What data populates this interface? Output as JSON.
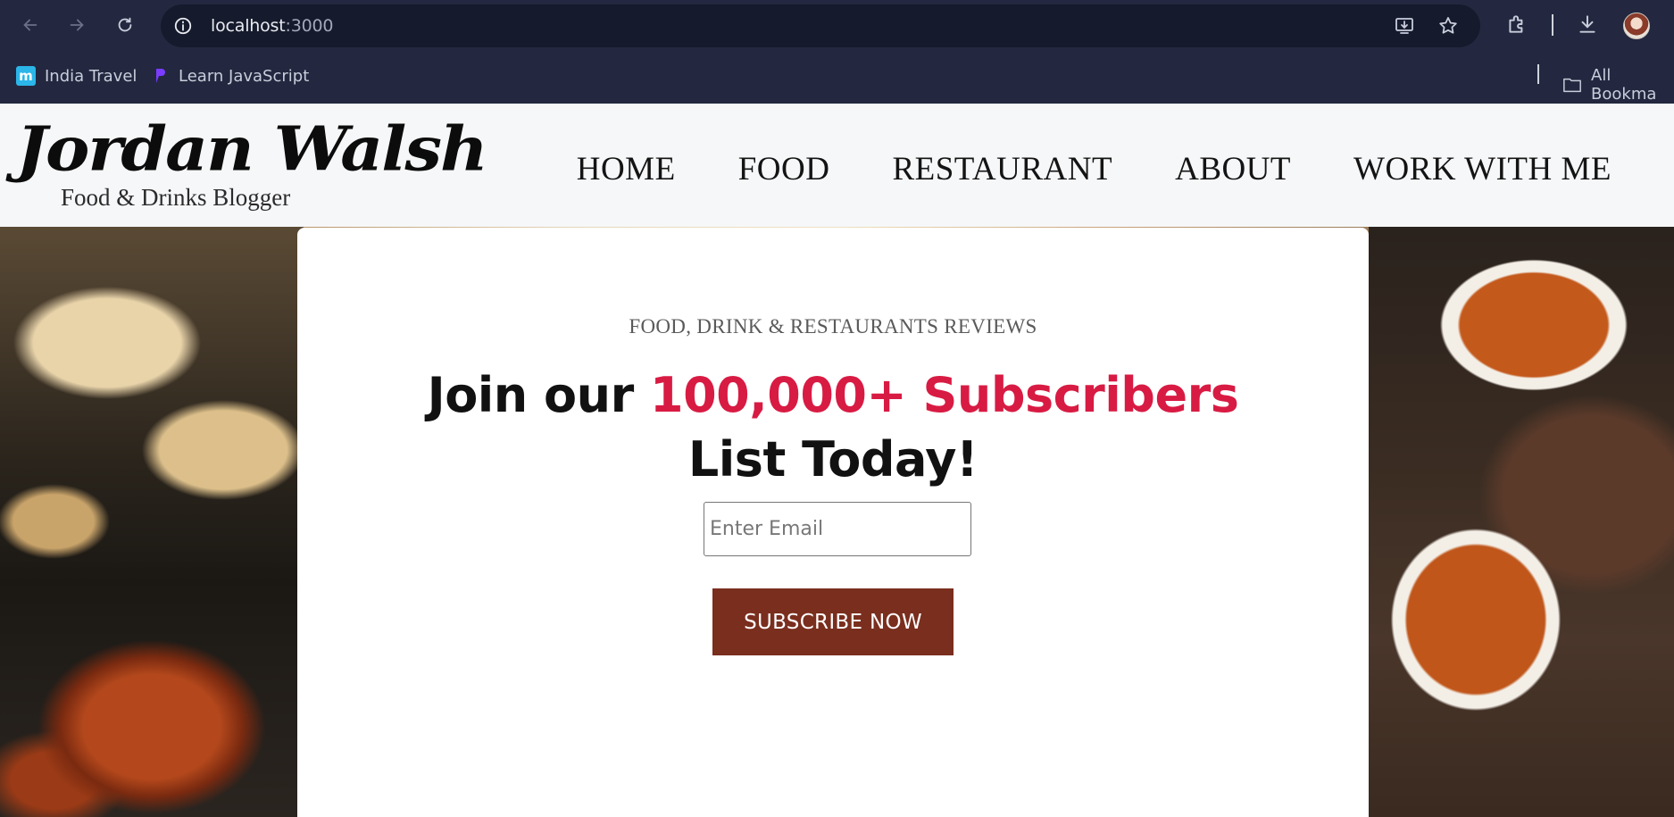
{
  "browser": {
    "url_host": "localhost",
    "url_port": ":3000",
    "bookmarks": [
      {
        "label": "India Travel",
        "favicon": "m"
      },
      {
        "label": "Learn JavaScript",
        "favicon": ""
      }
    ],
    "bookmarks_folder": "All Bookma"
  },
  "site": {
    "logo_script": "Jordan Walsh",
    "logo_tagline": "Food & Drinks Blogger",
    "nav": [
      "HOME",
      "FOOD",
      "RESTAURANT",
      "ABOUT",
      "WORK WITH ME"
    ]
  },
  "hero": {
    "eyebrow": "FOOD, DRINK & RESTAURANTS REVIEWS",
    "headline_pre": "Join our ",
    "headline_accent": "100,000+ Subscribers",
    "headline_post": "List Today!",
    "email_placeholder": "Enter Email",
    "button_label": "SUBSCRIBE NOW"
  },
  "colors": {
    "chrome_bg": "#232840",
    "accent": "#d81b43",
    "button_bg": "#7a2e1e"
  }
}
